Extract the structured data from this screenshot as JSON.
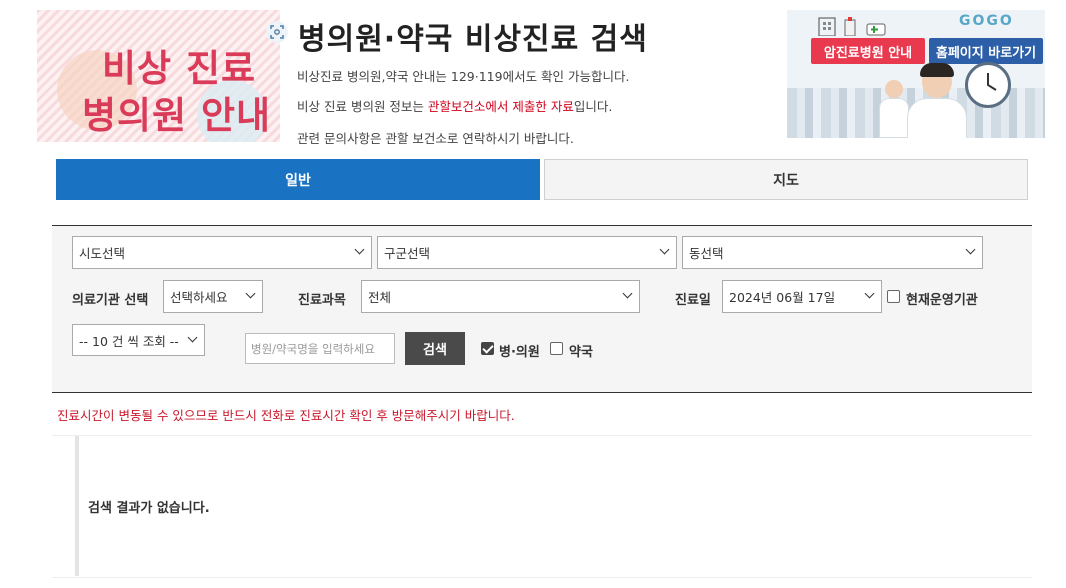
{
  "logo": {
    "line1": "비상 진료",
    "line2": "병의원 안내"
  },
  "header": {
    "title": "병의원·약국 비상진료 검색",
    "desc1": "비상진료 병의원,약국 안내는 129·119에서도 확인 가능합니다.",
    "desc2_prefix": "비상 진료 병의원 정보는 ",
    "desc2_highlight": "관할보건소에서 제출한 자료",
    "desc2_suffix": "입니다.",
    "desc3": "관련 문의사항은 관할 보건소로 연락하시기 바랍니다."
  },
  "banner": {
    "cancer_button": "암진료병원 안내",
    "homepage_button": "홈페이지 바로가기",
    "gogo_text": "GOGO"
  },
  "tabs": {
    "general": "일반",
    "map": "지도"
  },
  "filters": {
    "sido": "시도선택",
    "gugun": "구군선택",
    "dong": "동선택",
    "institution_label": "의료기관 선택",
    "institution_value": "선택하세요",
    "dept_label": "진료과목",
    "dept_value": "전체",
    "date_label": "진료일",
    "date_value": "2024년 06월 17일",
    "open_now_label": "현재운영기관",
    "page_size": "-- 10 건 씩 조회 --",
    "search_placeholder": "병원/약국명을 입력하세요",
    "search_button": "검색",
    "hospital_label": "병·의원",
    "pharmacy_label": "약국"
  },
  "notice": "진료시간이 변동될 수 있으므로 반드시 전화로 진료시간 확인 후 방문해주시기 바랍니다.",
  "result": {
    "empty_text": "검색 결과가 없습니다."
  },
  "colors": {
    "primary": "#1a72c2",
    "accent": "#d93b59",
    "notice": "#c9182b"
  }
}
